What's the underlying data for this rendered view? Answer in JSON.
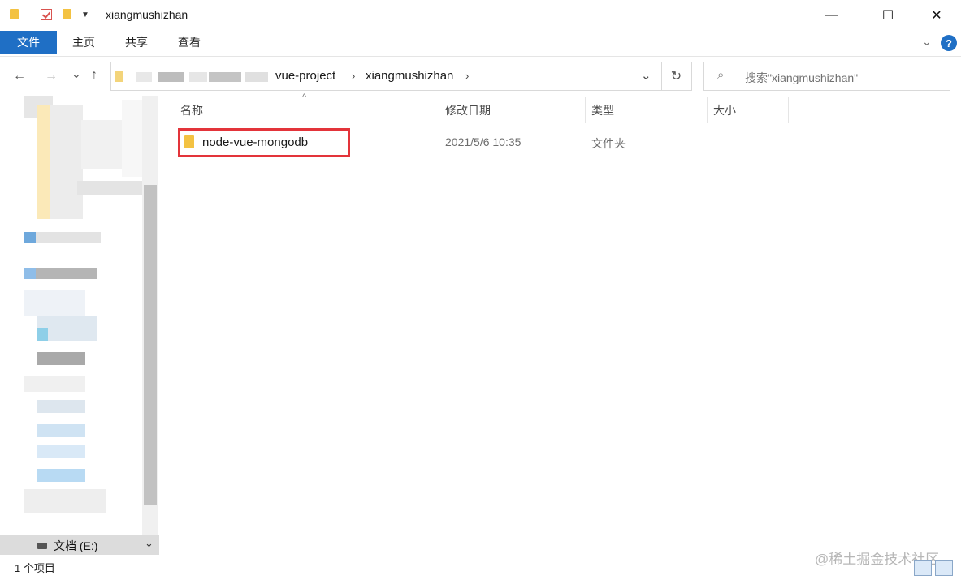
{
  "window": {
    "title": "xiangmushizhan",
    "controls": {
      "minimize": "—",
      "maximize": "☐",
      "close": "✕"
    }
  },
  "ribbon": {
    "tabs": [
      {
        "label": "文件",
        "active": true
      },
      {
        "label": "主页",
        "active": false
      },
      {
        "label": "共享",
        "active": false
      },
      {
        "label": "查看",
        "active": false
      }
    ],
    "help": "?"
  },
  "nav": {
    "back": "←",
    "forward": "→",
    "recent": "⌄",
    "up": "↑"
  },
  "address": {
    "breadcrumbs": [
      "vue-project",
      "xiangmushizhan"
    ]
  },
  "search": {
    "placeholder": "搜索\"xiangmushizhan\""
  },
  "columns": {
    "name": "名称",
    "date": "修改日期",
    "type": "类型",
    "size": "大小"
  },
  "files": [
    {
      "name": "node-vue-mongodb",
      "date": "2021/5/6 10:35",
      "type": "文件夹",
      "size": ""
    }
  ],
  "sidebar": {
    "drive": "文档 (E:)"
  },
  "status": {
    "count": "1 个项目"
  },
  "watermark": "@稀土掘金技术社区",
  "colors": {
    "accent": "#1f6fc5",
    "folder": "#f3c242",
    "highlight": "#e3343a"
  }
}
